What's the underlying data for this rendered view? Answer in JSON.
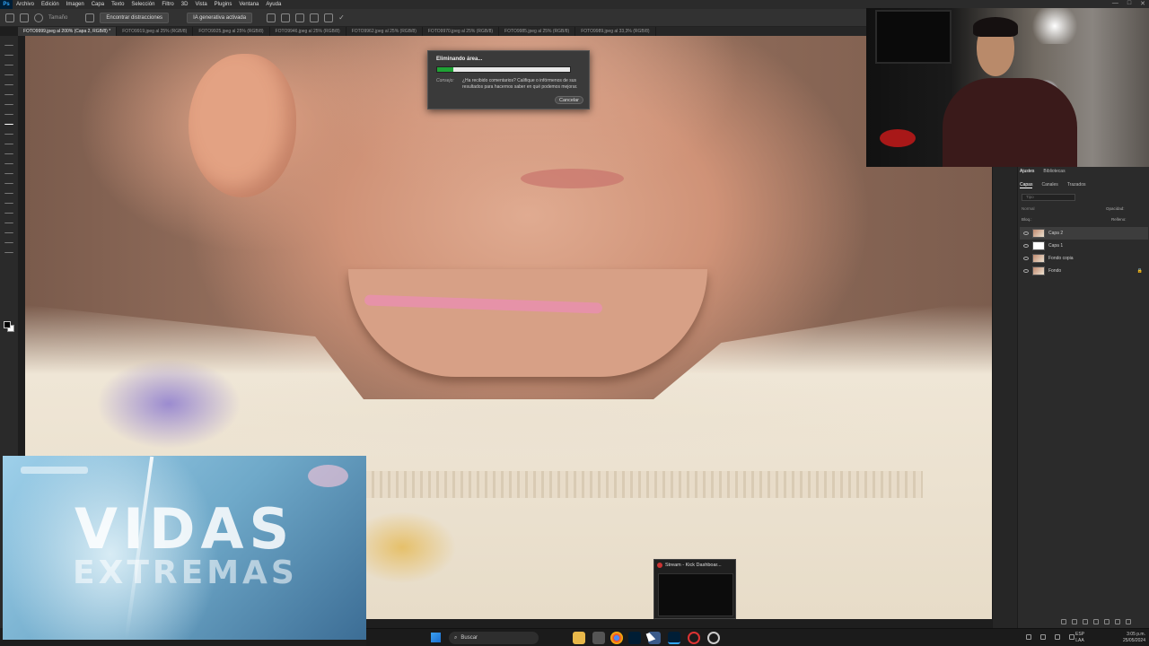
{
  "app": {
    "menu": [
      "Archivo",
      "Edición",
      "Imagen",
      "Capa",
      "Texto",
      "Selección",
      "Filtro",
      "3D",
      "Vista",
      "Plugins",
      "Ventana",
      "Ayuda"
    ],
    "window_controls": [
      "—",
      "□",
      "✕"
    ]
  },
  "options_bar": {
    "size_label": "Tamaño",
    "distractions_button": "Encontrar distracciones",
    "generative_button": "IA generativa activada"
  },
  "tabs": [
    "FOTO9999.jpeg al 200% (Capa 2, RGB/8) *",
    "FOTO9919.jpeg al 25% (RGB/8)",
    "FOTO9925.jpeg al 25% (RGB/8)",
    "FOTO9946.jpeg al 25% (RGB/8)",
    "FOTO9962.jpeg al 25% (RGB/8)",
    "FOTO9970.jpeg al 25% (RGB/8)",
    "FOTO9985.jpeg al 25% (RGB/8)",
    "FOTO9989.jpeg al 33,3% (RGB/8)"
  ],
  "dialog": {
    "title": "Eliminando área...",
    "progress": 0.12,
    "tip_label": "Consejo:",
    "tip_text": "¿Ha recibido comentarios? Califique o infórmenos de sus resultados para hacernos saber en qué podemos mejorar.",
    "cancel_label": "Cancelar"
  },
  "panels": {
    "top_tabs": [
      "Ajustes",
      "Bibliotecas"
    ],
    "layer_tabs": [
      "Capas",
      "Canales",
      "Trazados"
    ],
    "search_placeholder": "Tipo",
    "blend_mode": "Normal",
    "opacity_label": "Opacidad:",
    "block_label": "Bloq.:",
    "fill_label": "Relleno:",
    "layers": [
      {
        "name": "Capa 2",
        "thumb": "photo",
        "active": true,
        "locked": false
      },
      {
        "name": "Capa 1",
        "thumb": "white",
        "active": false,
        "locked": false
      },
      {
        "name": "Fondo copia",
        "thumb": "photo",
        "active": false,
        "locked": false
      },
      {
        "name": "Fondo",
        "thumb": "photo",
        "active": false,
        "locked": true
      }
    ]
  },
  "overlay": {
    "title": "VIDAS",
    "subtitle": "EXTREMAS"
  },
  "stream_popup": {
    "title": "Stream - Kick Dashboar..."
  },
  "taskbar": {
    "search_label": "Buscar",
    "lang_top": "ESP",
    "lang_bottom": "LAA",
    "time": "3:05 p.m.",
    "date": "25/05/2024"
  },
  "colors": {
    "progress_fill": "#1fa335",
    "accent_blue": "#31a8ff",
    "brush_pink": "#e98fae"
  }
}
